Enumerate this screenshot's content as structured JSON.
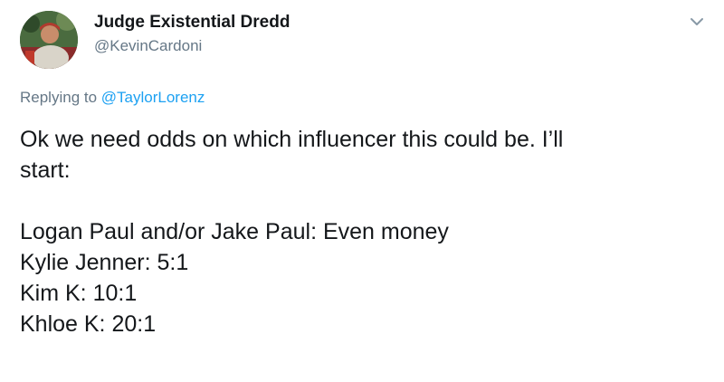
{
  "user": {
    "display_name": "Judge Existential Dredd",
    "handle": "@KevinCardoni"
  },
  "reply": {
    "prefix": "Replying to",
    "mention": "@TaylorLorenz"
  },
  "tweet": {
    "lines": [
      "Ok we need odds on which influencer this could be.  I’ll",
      "start:",
      "",
      "Logan Paul and/or Jake Paul: Even money",
      "Kylie Jenner: 5:1",
      "Kim K: 10:1",
      "Khloe K: 20:1"
    ]
  },
  "icons": {
    "avatar": "avatar-photo",
    "menu": "chevron-down-icon"
  },
  "colors": {
    "text": "#14171a",
    "secondary": "#657786",
    "link": "#1da1f2"
  }
}
